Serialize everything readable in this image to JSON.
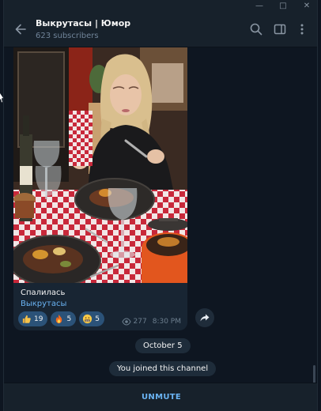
{
  "window": {
    "minimize_icon": "minimize-icon",
    "maximize_icon": "maximize-icon",
    "close_icon": "close-icon"
  },
  "header": {
    "title": "Выкрутасы | Юмор",
    "subscribers": "623 subscribers",
    "back_icon": "arrow-left-icon",
    "icons": [
      "search-icon",
      "sidebar-toggle-icon",
      "more-vertical-icon"
    ]
  },
  "message": {
    "caption": "Спалилась",
    "signature": "Выкрутасы",
    "reactions": [
      {
        "emoji": "thumbs-up",
        "count": "19"
      },
      {
        "emoji": "fire",
        "count": "5"
      },
      {
        "emoji": "grimacing-face",
        "count": "5"
      }
    ],
    "views": "277",
    "time": "8:30 PM",
    "share_icon": "share-icon"
  },
  "service": {
    "date": "October 5",
    "joined": "You joined this channel"
  },
  "composer": {
    "action": "UNMUTE"
  },
  "colors": {
    "background": "#0e1621",
    "header": "#17212b",
    "bubble": "#182533",
    "accent": "#6ab3f3",
    "reaction": "#2b5278",
    "muted_text": "#708499"
  }
}
